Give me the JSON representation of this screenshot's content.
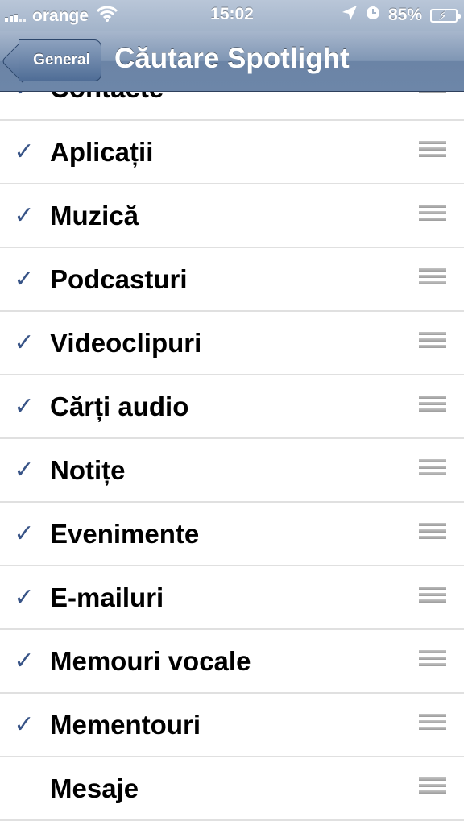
{
  "status_bar": {
    "carrier": "orange",
    "time": "15:02",
    "battery": "85%",
    "icons": [
      "signal-icon",
      "wifi-icon",
      "location-icon",
      "alarm-icon",
      "battery-charging-icon"
    ]
  },
  "nav": {
    "back_label": "General",
    "title": "Căutare Spotlight"
  },
  "list": {
    "items": [
      {
        "label": "Contacte",
        "checked": true
      },
      {
        "label": "Aplicații",
        "checked": true
      },
      {
        "label": "Muzică",
        "checked": true
      },
      {
        "label": "Podcasturi",
        "checked": true
      },
      {
        "label": "Videoclipuri",
        "checked": true
      },
      {
        "label": "Cărți audio",
        "checked": true
      },
      {
        "label": "Notițe",
        "checked": true
      },
      {
        "label": "Evenimente",
        "checked": true
      },
      {
        "label": "E-mailuri",
        "checked": true
      },
      {
        "label": "Memouri vocale",
        "checked": true
      },
      {
        "label": "Mementouri",
        "checked": true
      },
      {
        "label": "Mesaje",
        "checked": false
      }
    ],
    "check_glyph": "✓"
  },
  "colors": {
    "nav_bar": "#6d86a8",
    "check": "#385487"
  }
}
